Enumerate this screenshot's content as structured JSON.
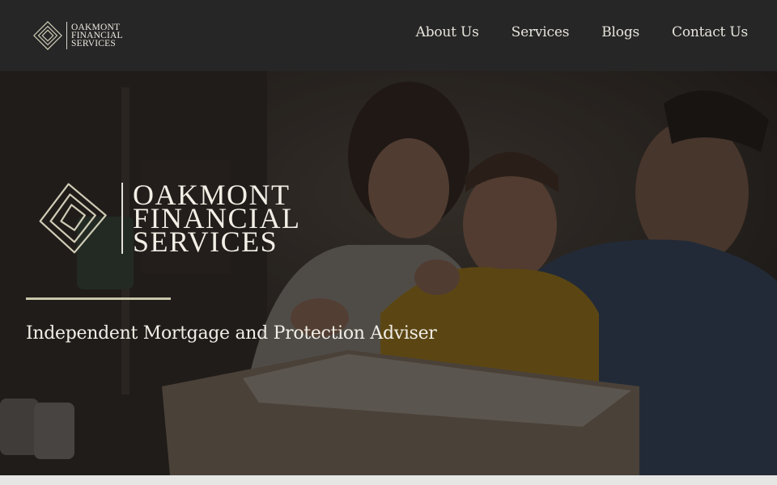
{
  "brand": {
    "name_lines": [
      "OAKMONT",
      "FINANCIAL",
      "SERVICES"
    ],
    "logo_icon": "nested-diamond-icon"
  },
  "nav": {
    "items": [
      {
        "label": "About Us"
      },
      {
        "label": "Services"
      },
      {
        "label": "Blogs"
      },
      {
        "label": "Contact Us"
      }
    ]
  },
  "hero": {
    "tagline": "Independent Mortgage and Protection Adviser",
    "image": "family-with-moving-box-photo"
  },
  "colors": {
    "nav_background": "#262626",
    "accent_rule": "#c9c6aa",
    "text_light": "#f1eee6"
  }
}
